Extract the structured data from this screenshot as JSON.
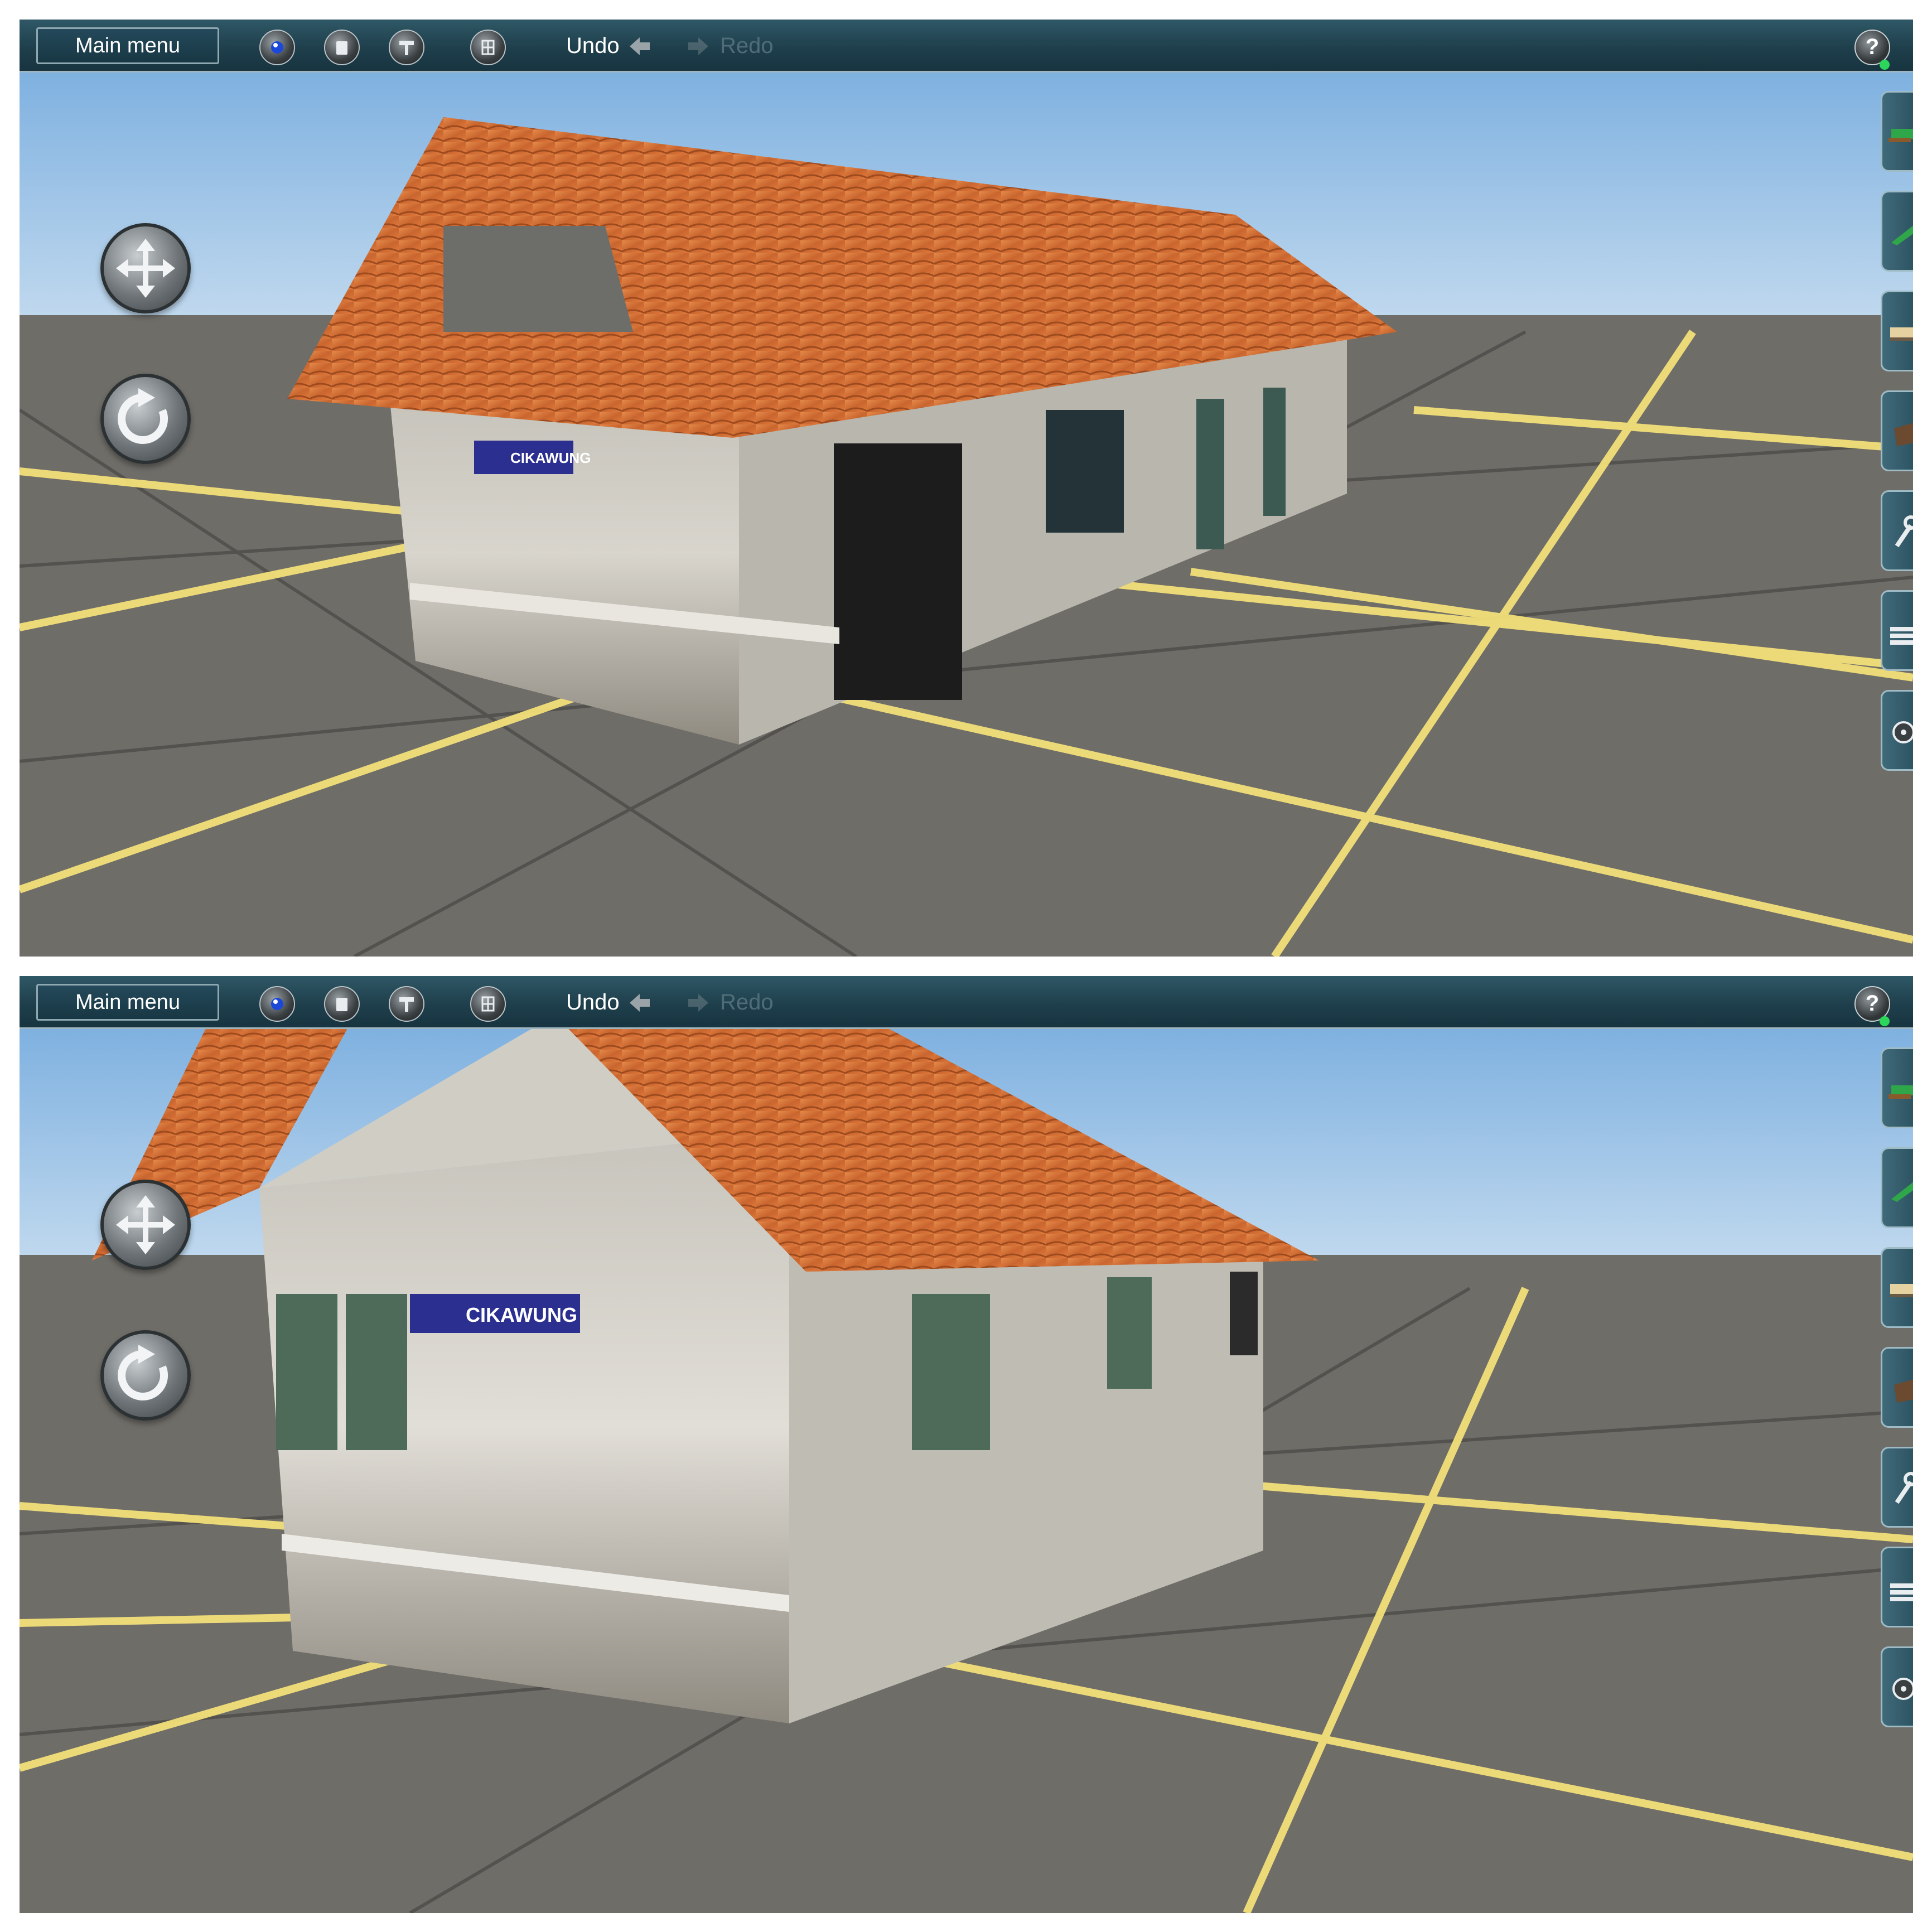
{
  "toolbar": {
    "main_menu_label": "Main menu",
    "undo_label": "Undo",
    "redo_label": "Redo",
    "help_label": "?"
  },
  "tools": [
    "globe-icon",
    "trash-icon",
    "hammer-icon",
    "grid-icon"
  ],
  "side_palette": [
    "locomotive-icon",
    "track-icon",
    "wagon-icon",
    "crate-icon",
    "wrench-icon",
    "layers-icon",
    "wheel-icon"
  ],
  "scene": {
    "station_sign": "CIKAWUNG",
    "colors": {
      "toolbar": "#1f3f4c",
      "ground": "#6f6d68",
      "grid_line": "#f3e07a",
      "roof": "#d9743a",
      "wall": "#c9c6bd",
      "sky": "#9cc3e6",
      "sign": "#2b2f8f"
    }
  }
}
